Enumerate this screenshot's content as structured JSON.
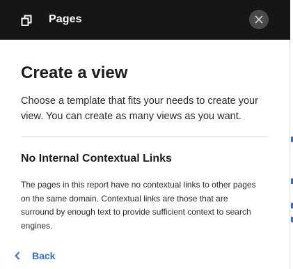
{
  "header": {
    "title": "Pages",
    "icon": "pages-icon",
    "close_icon": "close-icon"
  },
  "main": {
    "title": "Create a view",
    "intro": "Choose a template that fits your needs to create your view. You can create as many views as you want."
  },
  "section": {
    "title": "No Internal Contextual Links",
    "body": "The pages in this report have no contextual links to other pages on the same domain. Contextual links are those that are surround by enough text to provide sufficient context to search engines."
  },
  "footer": {
    "back_label": "Back",
    "back_icon": "chevron-left-icon"
  },
  "colors": {
    "header_bg": "#161616",
    "accent": "#2f6fd1",
    "text": "#1c1c1c"
  }
}
